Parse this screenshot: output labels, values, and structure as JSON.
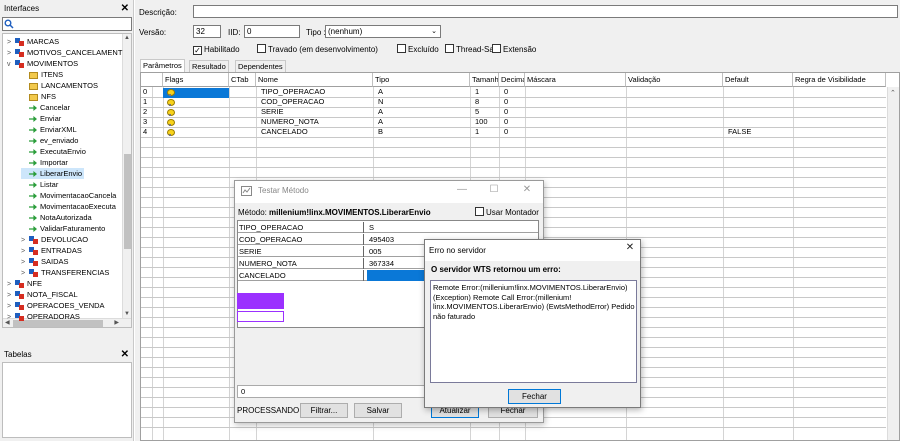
{
  "left": {
    "interfaces_title": "Interfaces",
    "tabelas_title": "Tabelas",
    "close_glyph": "✕",
    "tree": [
      {
        "label": "MARCAS",
        "toggle": ">",
        "icon": "module",
        "level": 0
      },
      {
        "label": "MOTIVOS_CANCELAMENT",
        "toggle": ">",
        "icon": "module",
        "level": 0
      },
      {
        "label": "MOVIMENTOS",
        "toggle": "v",
        "icon": "module",
        "level": 0
      },
      {
        "label": "ITENS",
        "toggle": "",
        "icon": "folder",
        "level": 1
      },
      {
        "label": "LANCAMENTOS",
        "toggle": "",
        "icon": "folder",
        "level": 1
      },
      {
        "label": "NFS",
        "toggle": "",
        "icon": "folder",
        "level": 1
      },
      {
        "label": "Cancelar",
        "toggle": "",
        "icon": "method",
        "level": 1
      },
      {
        "label": "Enviar",
        "toggle": "",
        "icon": "method",
        "level": 1
      },
      {
        "label": "EnviarXML",
        "toggle": "",
        "icon": "method",
        "level": 1
      },
      {
        "label": "ev_enviado",
        "toggle": "",
        "icon": "method",
        "level": 1
      },
      {
        "label": "ExecutaEnvio",
        "toggle": "",
        "icon": "method",
        "level": 1
      },
      {
        "label": "Importar",
        "toggle": "",
        "icon": "method",
        "level": 1
      },
      {
        "label": "LiberarEnvio",
        "toggle": "",
        "icon": "method",
        "level": 1
      },
      {
        "label": "Listar",
        "toggle": "",
        "icon": "method",
        "level": 1
      },
      {
        "label": "MovimentacaoCancela",
        "toggle": "",
        "icon": "method",
        "level": 1
      },
      {
        "label": "MovimentacaoExecuta",
        "toggle": "",
        "icon": "method",
        "level": 1
      },
      {
        "label": "NotaAutorizada",
        "toggle": "",
        "icon": "method",
        "level": 1
      },
      {
        "label": "ValidarFaturamento",
        "toggle": "",
        "icon": "method",
        "level": 1
      },
      {
        "label": "DEVOLUCAO",
        "toggle": ">",
        "icon": "module",
        "level": 1
      },
      {
        "label": "ENTRADAS",
        "toggle": ">",
        "icon": "module",
        "level": 1
      },
      {
        "label": "SAIDAS",
        "toggle": ">",
        "icon": "module",
        "level": 1
      },
      {
        "label": "TRANSFERENCIAS",
        "toggle": ">",
        "icon": "module",
        "level": 1
      },
      {
        "label": "NFE",
        "toggle": ">",
        "icon": "module",
        "level": 0
      },
      {
        "label": "NOTA_FISCAL",
        "toggle": ">",
        "icon": "module",
        "level": 0
      },
      {
        "label": "OPERACOES_VENDA",
        "toggle": ">",
        "icon": "module",
        "level": 0
      },
      {
        "label": "OPERADORAS",
        "toggle": ">",
        "icon": "module",
        "level": 0
      }
    ],
    "selected_index": 12
  },
  "form": {
    "descricao_label": "Descrição:",
    "descricao_value": "",
    "versao_label": "Versão:",
    "versao_value": "32",
    "iid_label": "IID:",
    "iid_value": "0",
    "tipo_label": "Tipo :",
    "tipo_value": "(nenhum)",
    "checks": [
      {
        "label": "Habilitado",
        "checked": true
      },
      {
        "label": "Travado (em desenvolvimento)",
        "checked": false
      },
      {
        "label": "Excluído",
        "checked": false
      },
      {
        "label": "Thread-Safe",
        "checked": false
      },
      {
        "label": "Extensão",
        "checked": false
      }
    ],
    "tabs": [
      "Parâmetros",
      "Resultado",
      "Dependentes"
    ]
  },
  "grid": {
    "headers": [
      "Flags",
      "CTab",
      "Nome",
      "Tipo",
      "Tamanh",
      "Decima",
      "Máscara",
      "Validação",
      "Default",
      "Regra de Visibilidade"
    ],
    "rows": [
      {
        "idx": "0",
        "nome": "TIPO_OPERACAO",
        "tipo": "A",
        "tam": "1",
        "dec": "0",
        "default": ""
      },
      {
        "idx": "1",
        "nome": "COD_OPERACAO",
        "tipo": "N",
        "tam": "8",
        "dec": "0",
        "default": ""
      },
      {
        "idx": "2",
        "nome": "SERIE",
        "tipo": "A",
        "tam": "5",
        "dec": "0",
        "default": ""
      },
      {
        "idx": "3",
        "nome": "NUMERO_NOTA",
        "tipo": "A",
        "tam": "100",
        "dec": "0",
        "default": ""
      },
      {
        "idx": "4",
        "nome": "CANCELADO",
        "tipo": "B",
        "tam": "1",
        "dec": "0",
        "default": "FALSE"
      }
    ]
  },
  "testar": {
    "title": "Testar Método",
    "metodo_label": "Método:",
    "metodo_value": "millenium!linx.MOVIMENTOS.LiberarEnvio",
    "usar_montador": "Usar Montador",
    "min_glyph": "—",
    "max_glyph": "☐",
    "close_glyph": "✕",
    "params": [
      {
        "name": "TIPO_OPERACAO",
        "value": "S"
      },
      {
        "name": "COD_OPERACAO",
        "value": "495403"
      },
      {
        "name": "SERIE",
        "value": "005"
      },
      {
        "name": "NUMERO_NOTA",
        "value": "367334"
      },
      {
        "name": "CANCELADO",
        "value": ""
      }
    ],
    "output_value": "0",
    "status": "PROCESSANDO",
    "btn_filtrar": "Filtrar...",
    "btn_salvar": "Salvar",
    "btn_atualizar": "Atualizar",
    "btn_fechar": "Fechar"
  },
  "erro": {
    "title": "Erro no servidor",
    "close_glyph": "✕",
    "heading": "O servidor WTS retornou um erro:",
    "lines": [
      "Remote Error:(millenium!linx.MOVIMENTOS.LiberarEnvio)",
      "(Exception) Remote Call Error:(millenium!",
      "linx.MOVIMENTOS.LiberarEnvio) (EwtsMethodError) Pedido",
      "não faturado"
    ],
    "btn_fechar": "Fechar"
  },
  "colors": {
    "selection": "#0a78d7",
    "purple": "#9b30ff",
    "bulb": "#f7d21b"
  }
}
